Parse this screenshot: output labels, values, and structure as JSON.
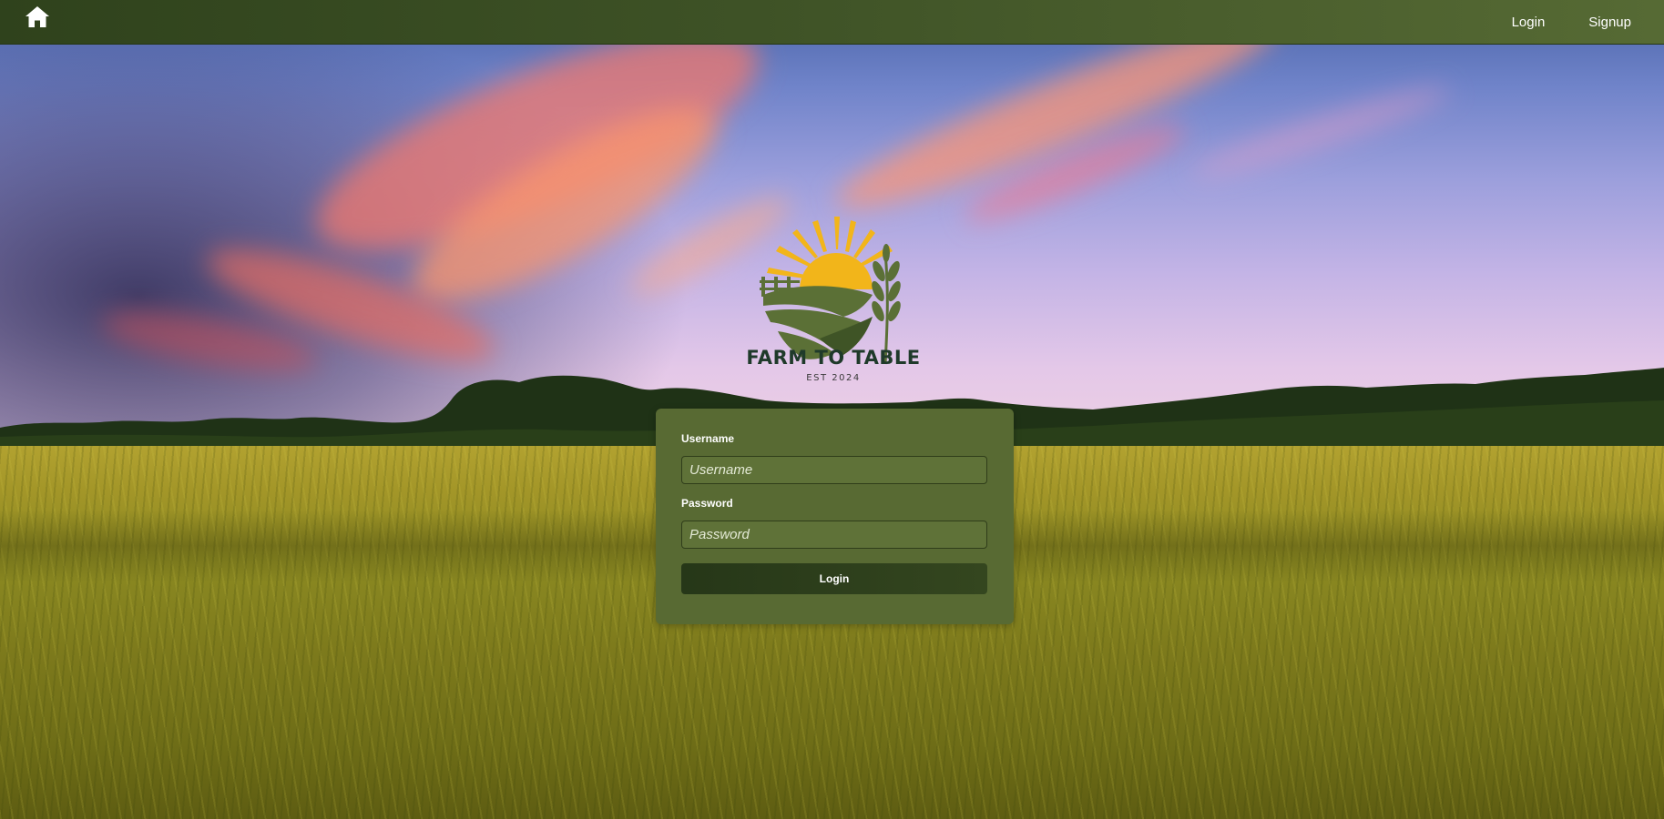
{
  "nav": {
    "home_icon": "home-icon",
    "links": [
      "Login",
      "Signup"
    ]
  },
  "brand": {
    "name": "FARM TO TABLE",
    "established": "EST 2024"
  },
  "login_form": {
    "username_label": "Username",
    "username_placeholder": "Username",
    "username_value": "",
    "password_label": "Password",
    "password_placeholder": "Password",
    "password_value": "",
    "submit_label": "Login"
  },
  "colors": {
    "nav_bg": "#3e5226",
    "card_bg": "#586a33",
    "button_bg": "#2c3e1c",
    "sun": "#f2b51a",
    "field_green": "#5b7036",
    "brand_text": "#1f3a2a"
  }
}
